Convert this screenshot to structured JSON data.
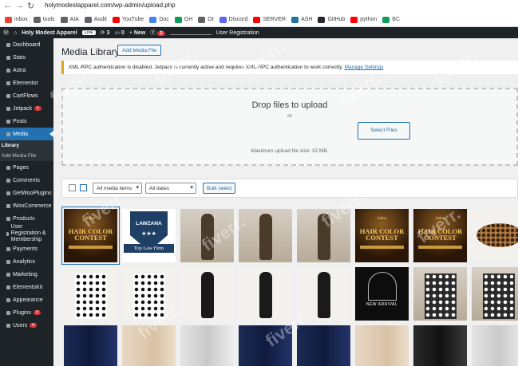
{
  "browser": {
    "url": "holymodestapparel.com/wp-admin/upload.php",
    "bookmarks": [
      {
        "label": "inbox",
        "icon": "gmail-icon",
        "color": "#ea4335"
      },
      {
        "label": "tools",
        "icon": "folder-icon",
        "color": "#5f6368"
      },
      {
        "label": "AIA",
        "icon": "folder-icon",
        "color": "#5f6368"
      },
      {
        "label": "Audit",
        "icon": "folder-icon",
        "color": "#5f6368"
      },
      {
        "label": "YouTube",
        "icon": "youtube-icon",
        "color": "#ff0000"
      },
      {
        "label": "Doc",
        "icon": "docs-icon",
        "color": "#4285f4"
      },
      {
        "label": "GH",
        "icon": "sheets-icon",
        "color": "#0f9d58"
      },
      {
        "label": "Ot",
        "icon": "generic-icon",
        "color": "#5f6368"
      },
      {
        "label": "Discord",
        "icon": "discord-icon",
        "color": "#5865f2"
      },
      {
        "label": "SERVER",
        "icon": "youtube-icon",
        "color": "#ff0000"
      },
      {
        "label": "ASH",
        "icon": "wordpress-icon",
        "color": "#21759b"
      },
      {
        "label": "GitHub",
        "icon": "github-icon",
        "color": "#24292f"
      },
      {
        "label": "python",
        "icon": "youtube-icon",
        "color": "#ff0000"
      },
      {
        "label": "BC",
        "icon": "sheets-icon",
        "color": "#0f9d58"
      }
    ]
  },
  "adminbar": {
    "site_name": "Holy Modest Apparel",
    "live_label": "Live",
    "updates_count": "3",
    "comments_count": "0",
    "new_label": "New",
    "notif_count": "2",
    "user_reg_label": "User Registration"
  },
  "sidebar": {
    "items": [
      {
        "label": "Dashboard"
      },
      {
        "label": "Stats"
      },
      {
        "label": "Astra"
      },
      {
        "label": "Elementor"
      },
      {
        "label": "CartFlows"
      },
      {
        "label": "Jetpack",
        "badge": "1"
      },
      {
        "label": "Posts"
      },
      {
        "label": "Media",
        "active": true
      },
      {
        "label": "Pages"
      },
      {
        "label": "Comments"
      },
      {
        "label": "GetWooPlugins"
      },
      {
        "label": "WooCommerce"
      },
      {
        "label": "Products"
      },
      {
        "label": "User Registration & Membership"
      },
      {
        "label": "Payments"
      },
      {
        "label": "Analytics"
      },
      {
        "label": "Marketing"
      },
      {
        "label": "ElementsKit"
      },
      {
        "label": "Appearance"
      },
      {
        "label": "Plugins",
        "badge": "3"
      },
      {
        "label": "Users",
        "badge": "5"
      }
    ],
    "media_sub": [
      "Library",
      "Add Media File"
    ]
  },
  "page": {
    "title": "Media Library",
    "add_new_label": "Add Media File",
    "notice_text": "XML-RPC authentication is disabled. Jetpack is currently active and requires XML-RPC authentication to work correctly.",
    "notice_link": "Manage Settings",
    "drop_title": "Drop files to upload",
    "drop_or": "or",
    "select_files_label": "Select Files",
    "max_size": "Maximum upload file size: 32 MB.",
    "filter_type": "All media items",
    "filter_date": "All dates",
    "bulk_label": "Bulk select"
  },
  "grid": {
    "hair_small": "Salon",
    "hair_big": "HAIR COLOR CONTEST",
    "law_brand": "LAWZANA",
    "law_stars": "★★★",
    "law_ribbon": "Top Law Firm",
    "new_arrival": "NEW ARRIVAL"
  },
  "watermark": "fiverr."
}
